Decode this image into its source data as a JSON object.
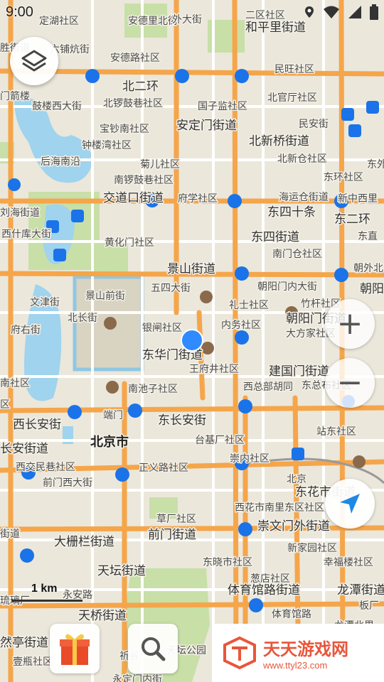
{
  "status_bar": {
    "time": "9:00"
  },
  "colors": {
    "major_road": "#f5a54a",
    "road_white": "#ffffff",
    "water": "#9fd3ee",
    "park": "#c6dfa4",
    "location": "#2f8bff",
    "subway": "#1a73e8"
  },
  "map": {
    "labels": [
      {
        "text": "定湖社区",
        "cls": "lbl"
      },
      {
        "text": "安德里北街",
        "cls": "lbl"
      },
      {
        "text": "外大街",
        "cls": "lbl"
      },
      {
        "text": "二区社区",
        "cls": "lbl"
      },
      {
        "text": "和平里街道",
        "cls": "lbl lbl-big"
      },
      {
        "text": "胜街道",
        "cls": "lbl"
      },
      {
        "text": "六铺炕街",
        "cls": "lbl"
      },
      {
        "text": "安德路社区",
        "cls": "lbl"
      },
      {
        "text": "民旺社区",
        "cls": "lbl"
      },
      {
        "text": "北二环",
        "cls": "lbl lbl-big"
      },
      {
        "text": "门箭楼",
        "cls": "lbl"
      },
      {
        "text": "北锣鼓巷社区",
        "cls": "lbl"
      },
      {
        "text": "国子监社区",
        "cls": "lbl"
      },
      {
        "text": "北官厅社区",
        "cls": "lbl"
      },
      {
        "text": "鼓楼西大街",
        "cls": "lbl"
      },
      {
        "text": "宝钞南社区",
        "cls": "lbl"
      },
      {
        "text": "安定门街道",
        "cls": "lbl lbl-big"
      },
      {
        "text": "民安街",
        "cls": "lbl"
      },
      {
        "text": "钟楼湾社区",
        "cls": "lbl"
      },
      {
        "text": "北新桥街道",
        "cls": "lbl lbl-big"
      },
      {
        "text": "后海南沿",
        "cls": "lbl"
      },
      {
        "text": "菊儿社区",
        "cls": "lbl"
      },
      {
        "text": "北新仓社区",
        "cls": "lbl"
      },
      {
        "text": "东外",
        "cls": "lbl"
      },
      {
        "text": "南锣鼓巷社区",
        "cls": "lbl"
      },
      {
        "text": "东环社区",
        "cls": "lbl"
      },
      {
        "text": "交道口街道",
        "cls": "lbl lbl-big"
      },
      {
        "text": "府学社区",
        "cls": "lbl"
      },
      {
        "text": "海运仓街道",
        "cls": "lbl"
      },
      {
        "text": "新中西里",
        "cls": "lbl"
      },
      {
        "text": "刘海街道",
        "cls": "lbl"
      },
      {
        "text": "东四十条",
        "cls": "lbl lbl-big"
      },
      {
        "text": "东二环",
        "cls": "lbl lbl-big"
      },
      {
        "text": "黄化门社区",
        "cls": "lbl"
      },
      {
        "text": "东四街道",
        "cls": "lbl lbl-big"
      },
      {
        "text": "东直",
        "cls": "lbl"
      },
      {
        "text": "西什库大街",
        "cls": "lbl"
      },
      {
        "text": "南门仓社区",
        "cls": "lbl"
      },
      {
        "text": "景山街道",
        "cls": "lbl lbl-big"
      },
      {
        "text": "朝外北",
        "cls": "lbl"
      },
      {
        "text": "五四大街",
        "cls": "lbl"
      },
      {
        "text": "朝阳门内大街",
        "cls": "lbl"
      },
      {
        "text": "朝阳",
        "cls": "lbl lbl-big"
      },
      {
        "text": "景山前街",
        "cls": "lbl"
      },
      {
        "text": "文津街",
        "cls": "lbl"
      },
      {
        "text": "礼士社区",
        "cls": "lbl"
      },
      {
        "text": "竹杆社区",
        "cls": "lbl"
      },
      {
        "text": "内务社区",
        "cls": "lbl"
      },
      {
        "text": "朝阳门街道",
        "cls": "lbl lbl-big"
      },
      {
        "text": "北长街",
        "cls": "lbl"
      },
      {
        "text": "银闸社区",
        "cls": "lbl"
      },
      {
        "text": "大方家社区",
        "cls": "lbl"
      },
      {
        "text": "府右街",
        "cls": "lbl"
      },
      {
        "text": "东华门街道",
        "cls": "lbl lbl-big"
      },
      {
        "text": "王府井社区",
        "cls": "lbl"
      },
      {
        "text": "建国门街道",
        "cls": "lbl lbl-big"
      },
      {
        "text": "南社区",
        "cls": "lbl"
      },
      {
        "text": "南池子社区",
        "cls": "lbl"
      },
      {
        "text": "西总部胡同",
        "cls": "lbl"
      },
      {
        "text": "东总布社区",
        "cls": "lbl"
      },
      {
        "text": "区",
        "cls": "lbl"
      },
      {
        "text": "端门",
        "cls": "lbl"
      },
      {
        "text": "西长安街",
        "cls": "lbl lbl-big"
      },
      {
        "text": "东长安街",
        "cls": "lbl lbl-big"
      },
      {
        "text": "北京市",
        "cls": "lbl lbl-city"
      },
      {
        "text": "台基厂社区",
        "cls": "lbl"
      },
      {
        "text": "站东社区",
        "cls": "lbl"
      },
      {
        "text": "长安街道",
        "cls": "lbl lbl-big"
      },
      {
        "text": "崇内社区",
        "cls": "lbl"
      },
      {
        "text": "西交民巷社区",
        "cls": "lbl"
      },
      {
        "text": "正义路社区",
        "cls": "lbl"
      },
      {
        "text": "前门西大街",
        "cls": "lbl"
      },
      {
        "text": "北京",
        "cls": "lbl"
      },
      {
        "text": "东花市街道",
        "cls": "lbl lbl-big"
      },
      {
        "text": "西花市南里东区社区",
        "cls": "lbl"
      },
      {
        "text": "街道",
        "cls": "lbl"
      },
      {
        "text": "草厂社区",
        "cls": "lbl"
      },
      {
        "text": "前门街道",
        "cls": "lbl lbl-big"
      },
      {
        "text": "崇文门外街道",
        "cls": "lbl lbl-big"
      },
      {
        "text": "大栅栏街道",
        "cls": "lbl lbl-big"
      },
      {
        "text": "新家园社区",
        "cls": "lbl"
      },
      {
        "text": "东晓市社区",
        "cls": "lbl"
      },
      {
        "text": "幸福楼社区",
        "cls": "lbl"
      },
      {
        "text": "天坛街道",
        "cls": "lbl lbl-big"
      },
      {
        "text": "葱店社区",
        "cls": "lbl"
      },
      {
        "text": "永安路",
        "cls": "lbl"
      },
      {
        "text": "体育馆路街道",
        "cls": "lbl lbl-big"
      },
      {
        "text": "龙潭街道",
        "cls": "lbl lbl-big"
      },
      {
        "text": "琉璃厂",
        "cls": "lbl"
      },
      {
        "text": "天桥街道",
        "cls": "lbl lbl-big"
      },
      {
        "text": "体育馆路",
        "cls": "lbl"
      },
      {
        "text": "龙潭北里",
        "cls": "lbl"
      },
      {
        "text": "板厂",
        "cls": "lbl"
      },
      {
        "text": "然亭街道",
        "cls": "lbl lbl-big"
      },
      {
        "text": "祈谷",
        "cls": "lbl"
      },
      {
        "text": "天坛公园",
        "cls": "lbl"
      },
      {
        "text": "壹瓶社区",
        "cls": "lbl"
      },
      {
        "text": "永定门内街",
        "cls": "lbl"
      }
    ]
  },
  "scale": {
    "label": "1 km"
  },
  "controls": {
    "layers": "layers-icon",
    "zoom_in": "+",
    "zoom_out": "−",
    "locate": "navigation-arrow-icon",
    "gift": "gift-icon",
    "search": "search-icon"
  },
  "watermark": {
    "title": "天天游戏网",
    "url": "www.ttyl23.com"
  }
}
